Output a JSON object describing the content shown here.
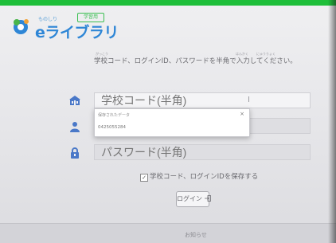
{
  "app": {
    "logo_small": "ものしり",
    "logo_text": "eライブラリ",
    "badge": "学習用"
  },
  "login": {
    "instruction": "学校コード、ログインID、パスワードを半角で入力してください。",
    "ruby_school": "がっこう",
    "ruby_half": "はんかく",
    "ruby_input": "にゅうりょく",
    "school_code_placeholder": "学校コード(半角)",
    "password_placeholder": "パスワード(半角)",
    "remember_label": "学校コード、ログインIDを保存する",
    "remember_checked": true,
    "login_button": "ログイン",
    "icons": {
      "school": "school-building-icon",
      "user": "user-icon",
      "password": "lock-icon",
      "login": "arrow-into-door-icon"
    }
  },
  "autocomplete": {
    "header": "保存されたデータ",
    "close": "×",
    "item": "0425055284"
  },
  "footer": {
    "news_link": "お知らせ"
  },
  "colors": {
    "brand_blue": "#2e86d6",
    "top_bar_green": "#1fbf3a"
  }
}
